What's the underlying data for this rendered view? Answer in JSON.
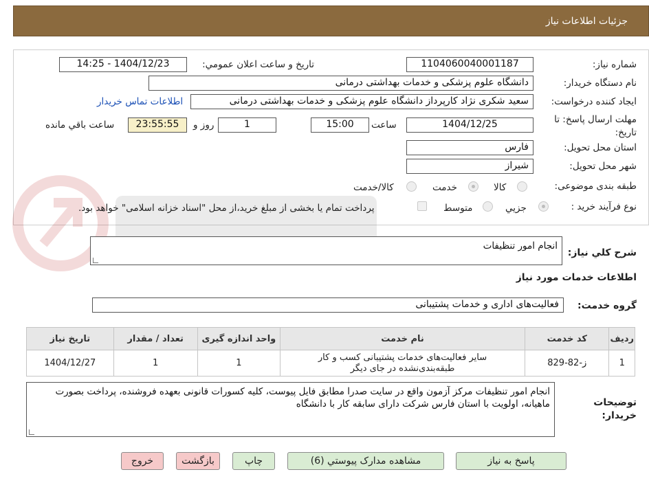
{
  "header": {
    "title": "جزئیات اطلاعات نیاز"
  },
  "form": {
    "need_number_label": "شماره نیاز:",
    "need_number": "1104060040001187",
    "announce_label": "تاریخ و ساعت اعلان عمومي:",
    "announce_value": "1404/12/23 - 14:25",
    "buyer_org_label": "نام دستگاه خریدار:",
    "buyer_org": "دانشگاه علوم پزشکی و خدمات بهداشتی درمانی",
    "requester_label": "ایجاد کننده درخواست:",
    "requester": "سعید شکری نژاد کارپرداز دانشگاه علوم پزشکی و خدمات بهداشتی درمانی",
    "contact_link": "اطلاعات تماس خریدار",
    "deadline_label": "مهلت ارسال پاسخ: تا تاریخ:",
    "deadline_date": "1404/12/25",
    "time_label": "ساعت",
    "deadline_time": "15:00",
    "days_value": "1",
    "days_label": "روز و",
    "remaining_time": "23:55:55",
    "remaining_label": "ساعت باقي مانده",
    "province_label": "استان محل تحویل:",
    "province": "فارس",
    "city_label": "شهر محل تحویل:",
    "city": "شیراز",
    "category_label": "طبقه بندی موضوعی:",
    "category_options": [
      "کالا",
      "خدمت",
      "کالا/خدمت"
    ],
    "category_selected": "خدمت",
    "process_label": "نوع فرآیند خرید :",
    "process_options": [
      "جزيي",
      "متوسط"
    ],
    "process_selected": "جزيي",
    "payment_note": "پرداخت تمام یا بخشی از مبلغ خرید،از محل \"اسناد خزانه اسلامی\" خواهد بود."
  },
  "summary": {
    "label": "شرح کلي نياز:",
    "value": "انجام امور تنظیفات"
  },
  "services_section": {
    "title": "اطلاعات خدمات مورد نیاز",
    "group_label": "گروه خدمت:",
    "group_value": "فعالیت‌های اداری و خدمات پشتیبانی"
  },
  "table": {
    "headers": [
      "ردیف",
      "کد خدمت",
      "نام خدمت",
      "واحد اندازه گیری",
      "تعداد / مقدار",
      "تاریخ نیاز"
    ],
    "rows": [
      {
        "row": "1",
        "code": "ز-82-829",
        "name": "سایر فعالیت‌های خدمات پشتیبانی کسب و کار طبقه‌بندی‌نشده در جای دیگر",
        "unit": "1",
        "qty": "1",
        "date": "1404/12/27"
      }
    ]
  },
  "buyer_notes": {
    "label": "توضیحات خریدار:",
    "value": "انجام امور تنظیفات مرکز آزمون واقع در سایت صدرا مطابق فایل پیوست، کلیه کسورات قانونی بعهده فروشنده، پرداخت بصورت ماهیانه، اولویت با استان فارس شرکت دارای سابقه کار با دانشگاه"
  },
  "buttons": {
    "reply": "پاسخ به نیاز",
    "attachments": "مشاهده مدارک پیوستي (6)",
    "print": "چاپ",
    "back": "بازگشت",
    "exit": "خروج"
  },
  "colors": {
    "header_bg": "#8b6a3e",
    "link": "#1a4fb5",
    "button_green": "#d9ecd3",
    "button_pink": "#f6c9c9",
    "remaining_bg": "#f7f0c8"
  }
}
